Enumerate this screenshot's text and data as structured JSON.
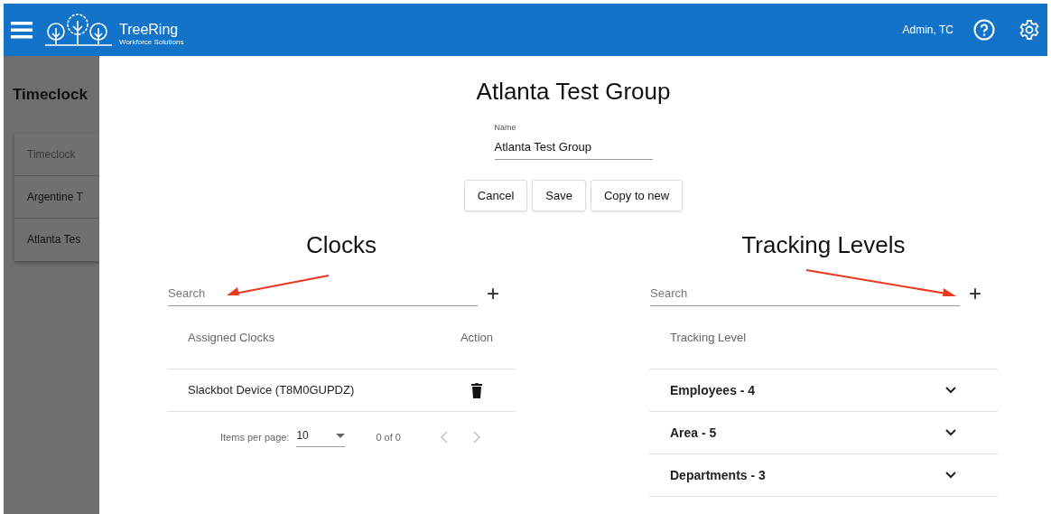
{
  "header": {
    "brand": "TreeRing",
    "tagline": "Workforce Solutions",
    "user": "Admin, TC"
  },
  "background": {
    "title": "Timeclock",
    "items": [
      {
        "label": "Timeclock",
        "selected": true
      },
      {
        "label": "Argentine T",
        "selected": false
      },
      {
        "label": "Atlanta Tes",
        "selected": false
      }
    ]
  },
  "dialog": {
    "title": "Atlanta Test Group",
    "name_field": {
      "label": "Name",
      "value": "Atlanta Test Group"
    },
    "buttons": [
      "Cancel",
      "Save",
      "Copy to new"
    ],
    "clocks": {
      "title": "Clocks",
      "search": {
        "placeholder": "Search"
      },
      "add": "+",
      "columns": [
        "Assigned Clocks",
        "Action"
      ],
      "rows": [
        {
          "name": "Slackbot Device (T8M0GUPDZ)"
        }
      ],
      "paginator": {
        "label": "Items per page:",
        "page_size": "10",
        "range": "0 of 0"
      }
    },
    "tracking": {
      "title": "Tracking Levels",
      "search": {
        "placeholder": "Search"
      },
      "add": "+",
      "column": "Tracking Level",
      "rows": [
        {
          "label": "Employees - 4",
          "expanded": false
        },
        {
          "label": "Area - 5",
          "expanded": false
        },
        {
          "label": "Departments - 3",
          "expanded": false
        }
      ]
    }
  }
}
